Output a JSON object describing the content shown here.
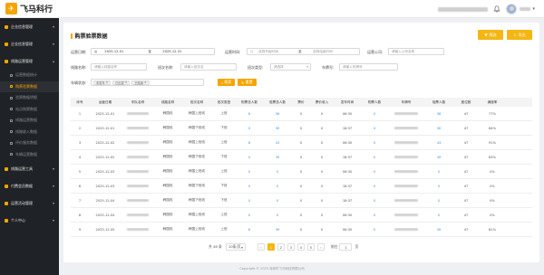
{
  "app": {
    "logo_text": "飞马科行",
    "copyright": "Copyright © 2025 深圳市飞马科技有限公司"
  },
  "sidebar": {
    "items": [
      {
        "label": "企业信息管理"
      },
      {
        "label": "企业信息管理"
      },
      {
        "label": "线路运营管理"
      },
      {
        "label": "线路运营工具"
      },
      {
        "label": "付费会员数据"
      },
      {
        "label": "运营活动管理"
      },
      {
        "label": "个人中心"
      }
    ],
    "subitems": [
      {
        "label": "运营数据统计"
      },
      {
        "label": "购票验票数据"
      },
      {
        "label": "验票数据明细"
      },
      {
        "label": "站点购票数据"
      },
      {
        "label": "线路运营数据"
      },
      {
        "label": "线路收入数据"
      },
      {
        "label": "评价服务数据"
      },
      {
        "label": "车辆运营数据"
      }
    ]
  },
  "page": {
    "title": "购票验票数据"
  },
  "toolbar": {
    "filter_label": "筛选",
    "export_label": "导出",
    "search_label": "搜索",
    "reset_label": "重置"
  },
  "filters": {
    "date_label": "运营日期:",
    "date_start": "2025-12-01",
    "date_sep": "至",
    "date_end": "2025-12-31",
    "time_label": "运营时间:",
    "time_start_ph": "选择开始时间",
    "time_sep": "至",
    "time_end_ph": "选择结束时间",
    "company_label": "运营公司:",
    "company_ph": "请输入公司名称",
    "line_label": "线路名称:",
    "line_ph": "请输入线路名称",
    "shift_label": "班次名称:",
    "shift_ph": "请输入班次名",
    "shift_type_label": "班次类型:",
    "shift_type_ph": "请选择",
    "plate_label": "车牌号:",
    "plate_ph": "请输入车牌号",
    "status_label": "车辆状态:",
    "status_tags": [
      "未发车",
      "已出发",
      "已结束"
    ]
  },
  "table": {
    "headers": [
      "序号",
      "运营日期",
      "车队名称",
      "线路名称",
      "班次名称",
      "班次类型",
      "购票总人数",
      "验票总人数",
      "票价",
      "票价收入",
      "发车时间",
      "购票人数",
      "车牌号",
      "验票人数",
      "座位数",
      "满座率"
    ],
    "rows": [
      {
        "no": "1",
        "date": "2025-12-01",
        "line": "韩国线",
        "shift": "韩国上班线",
        "type": "上班",
        "buy": "6",
        "check": "36",
        "price": "0",
        "income": "0",
        "depart": "06:30",
        "buy2": "0",
        "check2": "36",
        "seats": "47",
        "rate": "77%"
      },
      {
        "no": "2",
        "date": "2025-12-01",
        "line": "韩国线",
        "shift": "韩国下班线",
        "type": "下班",
        "buy": "0",
        "check": "30",
        "price": "0",
        "income": "0",
        "depart": "18:37",
        "buy2": "0",
        "check2": "30",
        "seats": "47",
        "rate": "64%"
      },
      {
        "no": "3",
        "date": "2025-12-02",
        "line": "韩国线",
        "shift": "韩国上班线",
        "type": "上班",
        "buy": "6",
        "check": "43",
        "price": "0",
        "income": "0",
        "depart": "06:30",
        "buy2": "0",
        "check2": "43",
        "seats": "47",
        "rate": "91%"
      },
      {
        "no": "4",
        "date": "2025-12-02",
        "line": "韩国线",
        "shift": "韩国下班线",
        "type": "下班",
        "buy": "0",
        "check": "39",
        "price": "0",
        "income": "0",
        "depart": "18:37",
        "buy2": "0",
        "check2": "39",
        "seats": "47",
        "rate": "83%"
      },
      {
        "no": "5",
        "date": "2025-12-03",
        "line": "韩国线",
        "shift": "韩国上班线",
        "type": "上班",
        "buy": "0",
        "check": "0",
        "price": "0",
        "income": "0",
        "depart": "06:30",
        "buy2": "0",
        "check2": "0",
        "seats": "47",
        "rate": "0%"
      },
      {
        "no": "6",
        "date": "2025-12-03",
        "line": "韩国线",
        "shift": "韩国下班线",
        "type": "下班",
        "buy": "0",
        "check": "0",
        "price": "0",
        "income": "0",
        "depart": "18:37",
        "buy2": "0",
        "check2": "0",
        "seats": "47",
        "rate": "0%"
      },
      {
        "no": "7",
        "date": "2025-12-04",
        "line": "韩国线",
        "shift": "韩国下班线",
        "type": "下班",
        "buy": "0",
        "check": "0",
        "price": "0",
        "income": "0",
        "depart": "18:37",
        "buy2": "0",
        "check2": "0",
        "seats": "47",
        "rate": "0%"
      },
      {
        "no": "8",
        "date": "2025-12-04",
        "line": "韩国线",
        "shift": "韩国上班线",
        "type": "上班",
        "buy": "0",
        "check": "0",
        "price": "0",
        "income": "0",
        "depart": "06:30",
        "buy2": "0",
        "check2": "0",
        "seats": "47",
        "rate": "0%"
      },
      {
        "no": "9",
        "date": "2025-12-05",
        "line": "韩国线",
        "shift": "韩国上班线",
        "type": "上班",
        "buy": "6",
        "check": "39",
        "price": "0",
        "income": "0",
        "depart": "06:30",
        "buy2": "0",
        "check2": "39",
        "seats": "47",
        "rate": "81%"
      }
    ]
  },
  "pagination": {
    "total": "共 46 条",
    "page_size": "10条/页",
    "pages": [
      "1",
      "2",
      "3",
      "4",
      "5"
    ],
    "goto_label": "前往",
    "goto_value": "1",
    "page_unit": "页"
  },
  "colors": {
    "accent": "#f5b614",
    "link": "#3a8ee6",
    "sidebar_bg": "#1f2226"
  }
}
